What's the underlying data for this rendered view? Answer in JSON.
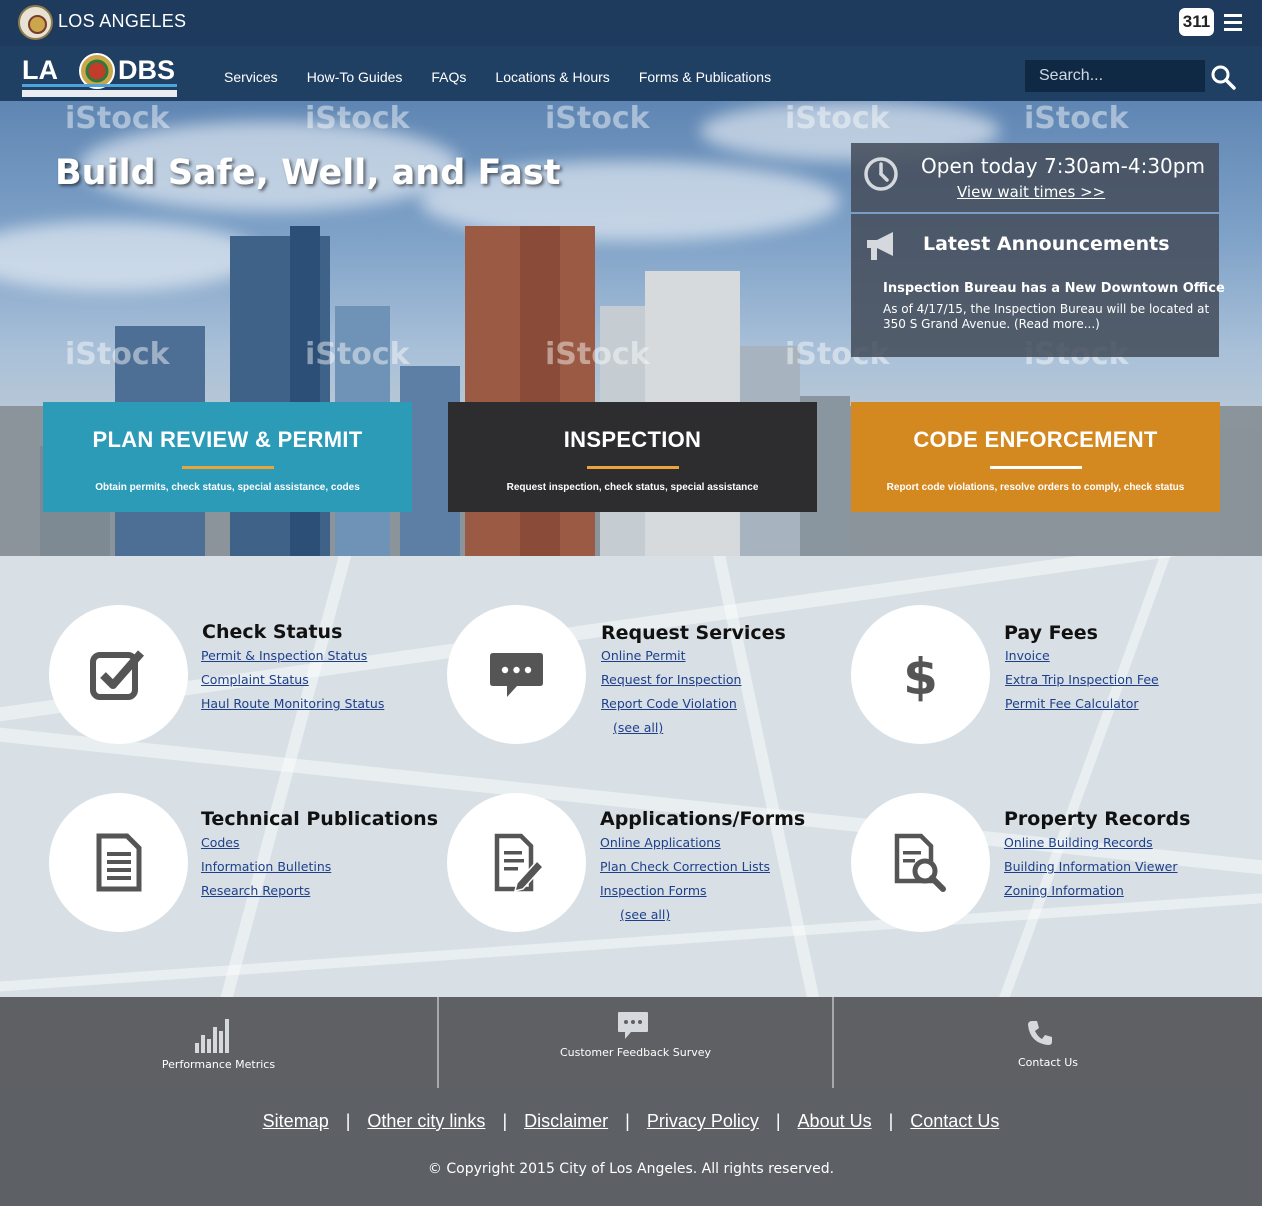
{
  "topbar": {
    "city_name": "LOS ANGELES",
    "btn_311": "311"
  },
  "nav": {
    "logo_text": "LA DBS",
    "items": [
      "Services",
      "How-To Guides",
      "FAQs",
      "Locations & Hours",
      "Forms & Publications"
    ],
    "search_placeholder": "Search..."
  },
  "hero": {
    "title": "Build Safe, Well, and Fast",
    "watermark": "iStock",
    "hours": "Open today 7:30am-4:30pm",
    "wait_link": "View wait times >>",
    "announcements": {
      "title": "Latest Announcements",
      "headline": "Inspection Bureau has a New Downtown Office",
      "body": "As of 4/17/15, the Inspection Bureau will be located at 350 S Grand Avenue.   (Read more...)"
    },
    "categories": [
      {
        "title": "PLAN REVIEW & PERMIT",
        "subtitle": "Obtain permits, check status, special assistance, codes"
      },
      {
        "title": "INSPECTION",
        "subtitle": "Request inspection, check status, special assistance"
      },
      {
        "title": "CODE ENFORCEMENT",
        "subtitle": "Report code violations, resolve orders to comply, check status"
      }
    ]
  },
  "services": [
    {
      "title": "Check Status",
      "icon": "checkbox-icon",
      "links": [
        "Permit & Inspection Status",
        "Complaint Status",
        "Haul Route Monitoring Status"
      ]
    },
    {
      "title": "Request Services",
      "icon": "chat-bubble-icon",
      "links": [
        "Online Permit",
        "Request for Inspection",
        "Report Code Violation",
        "(see all)"
      ]
    },
    {
      "title": "Pay Fees",
      "icon": "dollar-icon",
      "links": [
        "Invoice",
        "Extra Trip Inspection Fee",
        "Permit Fee Calculator"
      ]
    },
    {
      "title": "Technical Publications",
      "icon": "document-icon",
      "links": [
        "Codes",
        "Information Bulletins",
        "Research Reports"
      ]
    },
    {
      "title": "Applications/Forms",
      "icon": "form-edit-icon",
      "links": [
        "Online Applications",
        "Plan Check Correction Lists",
        "Inspection Forms",
        "(see all)"
      ]
    },
    {
      "title": "Property Records",
      "icon": "document-search-icon",
      "links": [
        "Online Building Records",
        "Building Information Viewer",
        "Zoning Information"
      ]
    }
  ],
  "footer_tiles": [
    {
      "label": "Performance Metrics",
      "icon": "bar-chart-icon"
    },
    {
      "label": "Customer Feedback Survey",
      "icon": "chat-bubble-icon"
    },
    {
      "label": "Contact Us",
      "icon": "phone-icon"
    }
  ],
  "footer": {
    "links": [
      "Sitemap",
      "Other city links",
      "Disclaimer",
      "Privacy Policy",
      "About Us",
      "Contact Us"
    ],
    "copyright": "© Copyright 2015 City of Los Angeles. All rights reserved."
  }
}
